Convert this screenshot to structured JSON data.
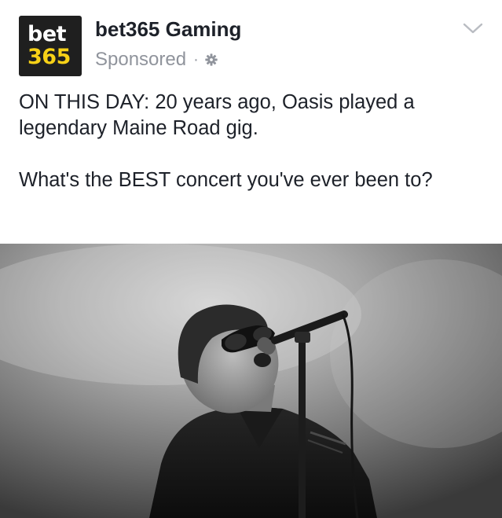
{
  "post": {
    "logo": {
      "line1": "bet",
      "line2": "365",
      "background_color": "#1f1f1f",
      "accent_color": "#f7d117"
    },
    "page_name": "bet365 Gaming",
    "sponsored_label": "Sponsored",
    "separator": "·",
    "icons": {
      "audience": "gear-icon",
      "menu": "chevron-down-icon"
    },
    "text_line1": "ON THIS DAY: 20 years ago, Oasis played a legendary Maine Road gig.",
    "text_line2": "What's the BEST concert you've ever been to?",
    "image": {
      "subject": "singer-at-microphone-photo",
      "style": "black-and-white"
    }
  }
}
